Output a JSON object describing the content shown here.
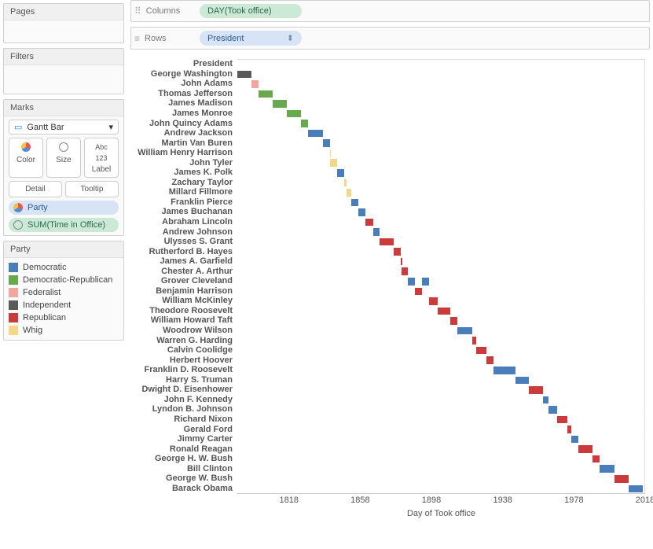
{
  "sidebar": {
    "pages_title": "Pages",
    "filters_title": "Filters",
    "marks_title": "Marks",
    "marks_type": "Gantt Bar",
    "btn_color": "Color",
    "btn_size": "Size",
    "btn_label": "Label",
    "btn_detail": "Detail",
    "btn_tooltip": "Tooltip",
    "pill_party": "Party",
    "pill_sum": "SUM(Time in Office)",
    "legend_title": "Party",
    "legend": [
      {
        "label": "Democratic",
        "color": "#4a7ebb"
      },
      {
        "label": "Democratic-Republican",
        "color": "#68a94f"
      },
      {
        "label": "Federalist",
        "color": "#f3a6a0"
      },
      {
        "label": "Independent",
        "color": "#5a5a5a"
      },
      {
        "label": "Republican",
        "color": "#cc3b3b"
      },
      {
        "label": "Whig",
        "color": "#f2d98a"
      }
    ]
  },
  "shelves": {
    "columns_label": "Columns",
    "columns_pill": "DAY(Took office)",
    "rows_label": "Rows",
    "rows_pill": "President"
  },
  "axis": {
    "xlabel": "Day of Took office",
    "header": "President",
    "ticks": [
      1818,
      1858,
      1898,
      1938,
      1978,
      2018
    ]
  },
  "chart_data": {
    "type": "bar",
    "title": "",
    "xlabel": "Day of Took office",
    "ylabel": "President",
    "xlim": [
      1789,
      2018
    ],
    "party_colors": {
      "Democratic": "#4a7ebb",
      "Democratic-Republican": "#68a94f",
      "Federalist": "#f3a6a0",
      "Independent": "#5a5a5a",
      "Republican": "#cc3b3b",
      "Whig": "#f2d98a"
    },
    "series": [
      {
        "name": "George Washington",
        "party": "Independent",
        "start": 1789,
        "end": 1797
      },
      {
        "name": "John Adams",
        "party": "Federalist",
        "start": 1797,
        "end": 1801
      },
      {
        "name": "Thomas Jefferson",
        "party": "Democratic-Republican",
        "start": 1801,
        "end": 1809
      },
      {
        "name": "James Madison",
        "party": "Democratic-Republican",
        "start": 1809,
        "end": 1817
      },
      {
        "name": "James Monroe",
        "party": "Democratic-Republican",
        "start": 1817,
        "end": 1825
      },
      {
        "name": "John Quincy Adams",
        "party": "Democratic-Republican",
        "start": 1825,
        "end": 1829
      },
      {
        "name": "Andrew Jackson",
        "party": "Democratic",
        "start": 1829,
        "end": 1837
      },
      {
        "name": "Martin Van Buren",
        "party": "Democratic",
        "start": 1837,
        "end": 1841
      },
      {
        "name": "William Henry Harrison",
        "party": "Whig",
        "start": 1841,
        "end": 1841.08
      },
      {
        "name": "John Tyler",
        "party": "Whig",
        "start": 1841.08,
        "end": 1845
      },
      {
        "name": "James K. Polk",
        "party": "Democratic",
        "start": 1845,
        "end": 1849
      },
      {
        "name": "Zachary Taylor",
        "party": "Whig",
        "start": 1849,
        "end": 1850.5
      },
      {
        "name": "Millard Fillmore",
        "party": "Whig",
        "start": 1850.5,
        "end": 1853
      },
      {
        "name": "Franklin Pierce",
        "party": "Democratic",
        "start": 1853,
        "end": 1857
      },
      {
        "name": "James Buchanan",
        "party": "Democratic",
        "start": 1857,
        "end": 1861
      },
      {
        "name": "Abraham Lincoln",
        "party": "Republican",
        "start": 1861,
        "end": 1865.3
      },
      {
        "name": "Andrew Johnson",
        "party": "Democratic",
        "start": 1865.3,
        "end": 1869
      },
      {
        "name": "Ulysses S. Grant",
        "party": "Republican",
        "start": 1869,
        "end": 1877
      },
      {
        "name": "Rutherford B. Hayes",
        "party": "Republican",
        "start": 1877,
        "end": 1881
      },
      {
        "name": "James A. Garfield",
        "party": "Republican",
        "start": 1881,
        "end": 1881.5
      },
      {
        "name": "Chester A. Arthur",
        "party": "Republican",
        "start": 1881.5,
        "end": 1885
      },
      {
        "name": "Grover Cleveland",
        "party": "Democratic",
        "start": 1885,
        "end": 1889,
        "second_start": 1893,
        "second_end": 1897
      },
      {
        "name": "Benjamin Harrison",
        "party": "Republican",
        "start": 1889,
        "end": 1893
      },
      {
        "name": "William McKinley",
        "party": "Republican",
        "start": 1897,
        "end": 1901.7
      },
      {
        "name": "Theodore Roosevelt",
        "party": "Republican",
        "start": 1901.7,
        "end": 1909
      },
      {
        "name": "William Howard Taft",
        "party": "Republican",
        "start": 1909,
        "end": 1913
      },
      {
        "name": "Woodrow Wilson",
        "party": "Democratic",
        "start": 1913,
        "end": 1921
      },
      {
        "name": "Warren G. Harding",
        "party": "Republican",
        "start": 1921,
        "end": 1923.6
      },
      {
        "name": "Calvin Coolidge",
        "party": "Republican",
        "start": 1923.6,
        "end": 1929
      },
      {
        "name": "Herbert Hoover",
        "party": "Republican",
        "start": 1929,
        "end": 1933
      },
      {
        "name": "Franklin D. Roosevelt",
        "party": "Democratic",
        "start": 1933,
        "end": 1945.3
      },
      {
        "name": "Harry S. Truman",
        "party": "Democratic",
        "start": 1945.3,
        "end": 1953
      },
      {
        "name": "Dwight D. Eisenhower",
        "party": "Republican",
        "start": 1953,
        "end": 1961
      },
      {
        "name": "John F. Kennedy",
        "party": "Democratic",
        "start": 1961,
        "end": 1963.9
      },
      {
        "name": "Lyndon B. Johnson",
        "party": "Democratic",
        "start": 1963.9,
        "end": 1969
      },
      {
        "name": "Richard Nixon",
        "party": "Republican",
        "start": 1969,
        "end": 1974.6
      },
      {
        "name": "Gerald Ford",
        "party": "Republican",
        "start": 1974.6,
        "end": 1977
      },
      {
        "name": "Jimmy Carter",
        "party": "Democratic",
        "start": 1977,
        "end": 1981
      },
      {
        "name": "Ronald Reagan",
        "party": "Republican",
        "start": 1981,
        "end": 1989
      },
      {
        "name": "George H. W. Bush",
        "party": "Republican",
        "start": 1989,
        "end": 1993
      },
      {
        "name": "Bill Clinton",
        "party": "Democratic",
        "start": 1993,
        "end": 2001
      },
      {
        "name": "George W. Bush",
        "party": "Republican",
        "start": 2001,
        "end": 2009
      },
      {
        "name": "Barack Obama",
        "party": "Democratic",
        "start": 2009,
        "end": 2017
      }
    ]
  }
}
